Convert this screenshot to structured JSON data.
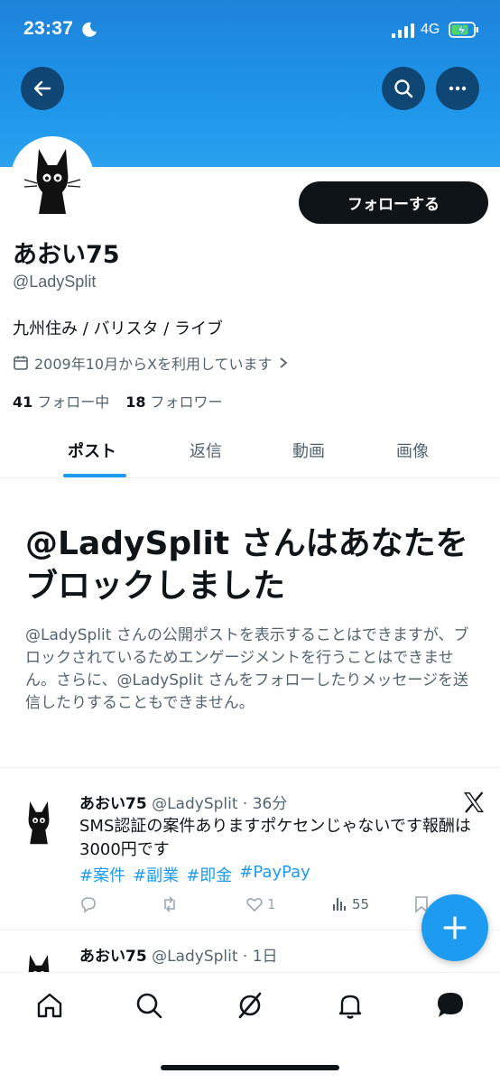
{
  "status_bar": {
    "time": "23:37",
    "network": "4G"
  },
  "profile": {
    "follow_label": "フォローする",
    "display_name": "あおい75",
    "handle": "@LadySplit",
    "bio": "九州住み / バリスタ / ライブ",
    "joined": "2009年10月からXを利用しています",
    "following_count": "41",
    "following_label": "フォロー中",
    "followers_count": "18",
    "followers_label": "フォロワー"
  },
  "tabs": [
    {
      "label": "ポスト",
      "active": true
    },
    {
      "label": "返信",
      "active": false
    },
    {
      "label": "動画",
      "active": false
    },
    {
      "label": "画像",
      "active": false
    }
  ],
  "blocked": {
    "title": "@LadySplit さんはあなたをブロックしました",
    "description": "@LadySplit さんの公開ポストを表示することはできますが、ブロックされているためエンゲージメントを行うことはできません。さらに、@LadySplit さんをフォローしたりメッセージを送信したりすることもできません。"
  },
  "tweets": [
    {
      "name": "あおい75",
      "handle_time": "@LadySplit · 36分",
      "text": "SMS認証の案件ありますポケセンじゃないです報酬は3000円です",
      "tags": [
        "#案件",
        "#副業",
        "#即金",
        "#PayPay"
      ],
      "likes": "1",
      "views": "55"
    },
    {
      "name": "あおい75",
      "handle_time": "@LadySplit · 1日"
    }
  ],
  "icons": {
    "back": "arrow-left-icon",
    "search": "search-icon",
    "more": "more-dots-icon",
    "calendar": "calendar-icon",
    "compose": "plus-icon",
    "nav": [
      "home-icon",
      "search-icon",
      "grok-icon",
      "bell-icon",
      "messages-icon"
    ]
  },
  "colors": {
    "accent": "#1d9bf0",
    "banner": "#1f95ea",
    "text": "#0f1419",
    "muted": "#536471"
  }
}
